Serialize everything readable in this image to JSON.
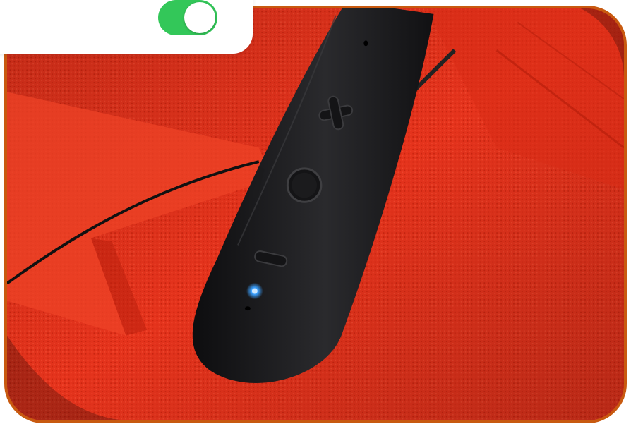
{
  "settings_card": {
    "toggle": {
      "state": "on",
      "on_color": "#33c759"
    }
  },
  "photo": {
    "subject": "neckband-headset-controls",
    "frame_color": "#c85a10",
    "shirt_color": "#e6341d",
    "device_color": "#1c1c1e",
    "led_color": "#3aa0ff",
    "icons": [
      "plus-icon",
      "circle-button-icon",
      "minus-icon",
      "led-indicator-icon"
    ]
  }
}
